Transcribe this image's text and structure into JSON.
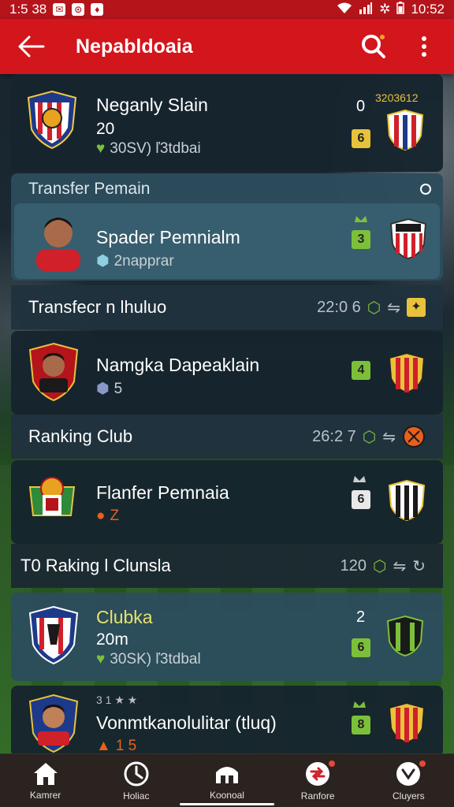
{
  "status_bar": {
    "time_left": "1:5 38",
    "time_right": "10:52"
  },
  "app_bar": {
    "title": "Nepabldoaia"
  },
  "items": [
    {
      "name": "Neganly Slain",
      "line2": "20",
      "sub": "30SV) ľ3tdbai",
      "num": "0",
      "top_label": "3203612",
      "badge": "6",
      "badge_color": "#e8c23a"
    },
    {
      "section": "Transfer Pemain"
    },
    {
      "name": "Spader Pemnialm",
      "sub": "2napprar",
      "badge": "3",
      "badge_color": "#7cc03a"
    },
    {
      "section": "Transfecr n lhuluo",
      "right": "22:0 6"
    },
    {
      "name": "Namgka Dapeaklain",
      "sub": "5",
      "badge": "4",
      "badge_color": "#7cc03a"
    },
    {
      "section": "Ranking Club",
      "right": "26:2 7"
    },
    {
      "name": "Flanfer Pemnaia",
      "sub": "Z",
      "badge": "6",
      "badge_color": "#e8e8e8"
    },
    {
      "section": "T0 Raking l Clunsla",
      "right": "120"
    },
    {
      "name": "Clubka",
      "line2": "20m",
      "sub": "30SK) ľ3tdbal",
      "num": "2",
      "badge": "6",
      "badge_color": "#7cc03a"
    },
    {
      "name": "Vonmtkanolulitar (tluq)",
      "sub": "1 5",
      "badge": "8",
      "badge_color": "#7cc03a",
      "top_label": "3 1 ★ ★"
    }
  ],
  "bottom_nav": [
    {
      "label": "Kamrer",
      "icon": "home-icon"
    },
    {
      "label": "Holiac",
      "icon": "clock-icon"
    },
    {
      "label": "Koonoal",
      "icon": "stadium-icon"
    },
    {
      "label": "Ranfore",
      "icon": "transfer-icon"
    },
    {
      "label": "Cluyers",
      "icon": "clubs-icon"
    }
  ]
}
